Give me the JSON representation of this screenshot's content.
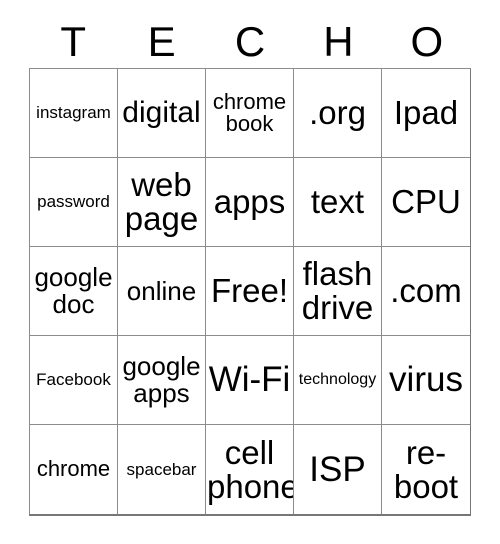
{
  "card": {
    "title_letters": [
      "T",
      "E",
      "C",
      "H",
      "O"
    ],
    "free_space_label": "Free!",
    "colors": {
      "background": "#ffffff",
      "text": "#000000",
      "grid_line": "#8c8c8c",
      "grid_outer": "#777777"
    },
    "grid": {
      "columns": 5,
      "rows": 5,
      "cells": [
        {
          "text": "instagram",
          "size": "fs-s",
          "lines": 1
        },
        {
          "text": "digital",
          "size": "fs-xl",
          "lines": 1
        },
        {
          "text": "chrome\nbook",
          "size": "fs-m",
          "lines": 2
        },
        {
          "text": ".org",
          "size": "fs-xxl",
          "lines": 1
        },
        {
          "text": "Ipad",
          "size": "fs-xxl",
          "lines": 1
        },
        {
          "text": "password",
          "size": "fs-s",
          "lines": 1
        },
        {
          "text": "web\npage",
          "size": "fs-xxl",
          "lines": 2
        },
        {
          "text": "apps",
          "size": "fs-xxl",
          "lines": 1
        },
        {
          "text": "text",
          "size": "fs-xxl",
          "lines": 1
        },
        {
          "text": "CPU",
          "size": "fs-xxl",
          "lines": 1
        },
        {
          "text": "google\ndoc",
          "size": "fs-l",
          "lines": 2
        },
        {
          "text": "online",
          "size": "fs-l",
          "lines": 1
        },
        {
          "text": "Free!",
          "size": "fs-xxl",
          "lines": 1
        },
        {
          "text": "flash\ndrive",
          "size": "fs-xxl",
          "lines": 2
        },
        {
          "text": ".com",
          "size": "fs-xxl",
          "lines": 1
        },
        {
          "text": "Facebook",
          "size": "fs-s",
          "lines": 1
        },
        {
          "text": "google\napps",
          "size": "fs-l",
          "lines": 2
        },
        {
          "text": "Wi-Fi",
          "size": "fs-xxxl",
          "lines": 1
        },
        {
          "text": "technology",
          "size": "fs-xs",
          "lines": 1
        },
        {
          "text": "virus",
          "size": "fs-xxxl",
          "lines": 1
        },
        {
          "text": "chrome",
          "size": "fs-m",
          "lines": 1
        },
        {
          "text": "spacebar",
          "size": "fs-s",
          "lines": 1
        },
        {
          "text": "cell\nphone",
          "size": "fs-xxl",
          "lines": 2
        },
        {
          "text": "ISP",
          "size": "fs-xxxl",
          "lines": 1
        },
        {
          "text": "re-\nboot",
          "size": "fs-xxl",
          "lines": 2
        }
      ]
    }
  }
}
